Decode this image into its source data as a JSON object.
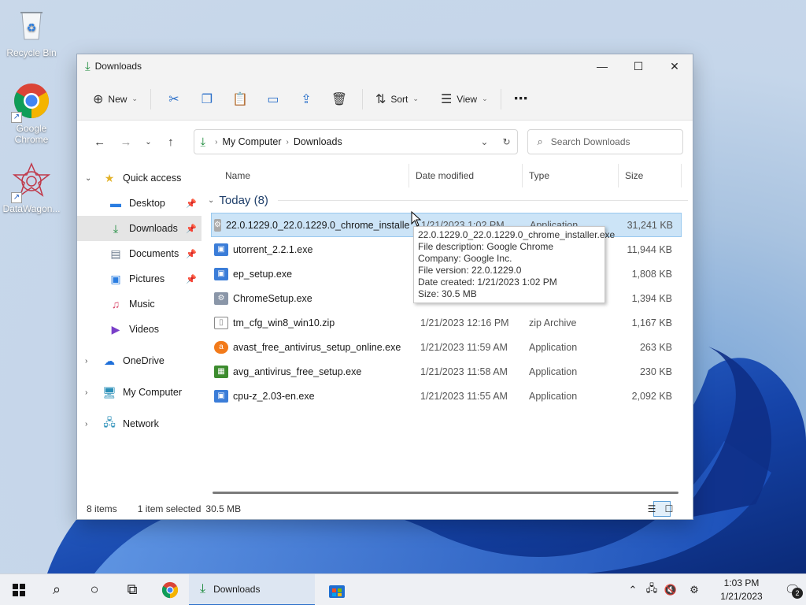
{
  "desktop": {
    "icons": [
      {
        "label": "Recycle Bin",
        "icon": "recycle-bin-icon"
      },
      {
        "label": "Google Chrome",
        "icon": "chrome-icon"
      },
      {
        "label": "DataWagon...",
        "icon": "datawagon-icon"
      }
    ]
  },
  "window": {
    "title": "Downloads",
    "toolbar": {
      "new_label": "New",
      "sort_label": "Sort",
      "view_label": "View",
      "more_label": "⋯"
    },
    "breadcrumb": [
      "My Computer",
      "Downloads"
    ],
    "search_placeholder": "Search Downloads",
    "sidebar": {
      "quick_access": "Quick access",
      "items": [
        {
          "label": "Desktop",
          "icon": "desktop-icon",
          "pinned": true
        },
        {
          "label": "Downloads",
          "icon": "downloads-icon",
          "pinned": true,
          "selected": true
        },
        {
          "label": "Documents",
          "icon": "documents-icon",
          "pinned": true
        },
        {
          "label": "Pictures",
          "icon": "pictures-icon",
          "pinned": true
        },
        {
          "label": "Music",
          "icon": "music-icon"
        },
        {
          "label": "Videos",
          "icon": "videos-icon"
        }
      ],
      "onedrive": "OneDrive",
      "my_computer": "My Computer",
      "network": "Network"
    },
    "columns": {
      "name": "Name",
      "date": "Date modified",
      "type": "Type",
      "size": "Size"
    },
    "group_label": "Today (8)",
    "files": [
      {
        "name": "22.0.1229.0_22.0.1229.0_chrome_installer....",
        "date": "1/21/2023 1:02 PM",
        "type": "Application",
        "size": "31,241 KB",
        "icon": "chrome-installer-icon",
        "selected": true
      },
      {
        "name": "utorrent_2.2.1.exe",
        "date": "",
        "type": "",
        "size": "11,944 KB",
        "icon": "exe-icon"
      },
      {
        "name": "ep_setup.exe",
        "date": "",
        "type": "",
        "size": "1,808 KB",
        "icon": "exe-icon"
      },
      {
        "name": "ChromeSetup.exe",
        "date": "",
        "type": "",
        "size": "1,394 KB",
        "icon": "chrome-setup-icon"
      },
      {
        "name": "tm_cfg_win8_win10.zip",
        "date": "1/21/2023 12:16 PM",
        "type": "zip Archive",
        "size": "1,167 KB",
        "icon": "zip-icon"
      },
      {
        "name": "avast_free_antivirus_setup_online.exe",
        "date": "1/21/2023 11:59 AM",
        "type": "Application",
        "size": "263 KB",
        "icon": "avast-icon"
      },
      {
        "name": "avg_antivirus_free_setup.exe",
        "date": "1/21/2023 11:58 AM",
        "type": "Application",
        "size": "230 KB",
        "icon": "avg-icon"
      },
      {
        "name": "cpu-z_2.03-en.exe",
        "date": "1/21/2023 11:55 AM",
        "type": "Application",
        "size": "2,092 KB",
        "icon": "exe-icon"
      }
    ],
    "tooltip": [
      "22.0.1229.0_22.0.1229.0_chrome_installer.exe",
      "File description: Google Chrome",
      "Company: Google Inc.",
      "File version: 22.0.1229.0",
      "Date created: 1/21/2023 1:02 PM",
      "Size: 30.5 MB"
    ],
    "status": {
      "count": "8 items",
      "selected": "1 item selected",
      "size": "30.5 MB"
    }
  },
  "taskbar": {
    "app_label": "Downloads",
    "time": "1:03 PM",
    "date": "1/21/2023",
    "notification_count": "2"
  }
}
